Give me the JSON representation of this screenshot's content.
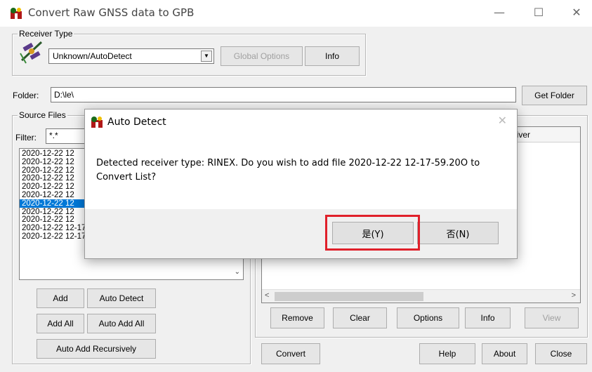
{
  "window": {
    "title": "Convert Raw GNSS data to GPB",
    "minimize": "—",
    "maximize": "☐",
    "close": "✕"
  },
  "receiver_type": {
    "group_label": "Receiver Type",
    "selected": "Unknown/AutoDetect",
    "global_options_label": "Global Options",
    "info_label": "Info"
  },
  "folder": {
    "label": "Folder:",
    "value": "D:\\le\\",
    "get_folder_label": "Get Folder"
  },
  "source_files": {
    "group_label": "Source Files",
    "filter_label": "Filter:",
    "filter_value": "*.*",
    "items": [
      "2020-12-22 12",
      "2020-12-22 12",
      "2020-12-22 12",
      "2020-12-22 12",
      "2020-12-22 12",
      "2020-12-22 12",
      "2020-12-22 12",
      "2020-12-22 12",
      "2020-12-22 12",
      "2020-12-22 12-17-59.fmnav",
      "2020-12-22 12-17-59.fpos"
    ],
    "selected_index": 6,
    "add_label": "Add",
    "auto_detect_label": "Auto Detect",
    "add_all_label": "Add All",
    "auto_add_all_label": "Auto Add All",
    "auto_add_recursively_label": "Auto Add Recursively"
  },
  "convert_list": {
    "column_header_partial": "eiver",
    "remove_label": "Remove",
    "clear_label": "Clear",
    "options_label": "Options",
    "info_label": "Info",
    "view_label": "View"
  },
  "bottom": {
    "convert_label": "Convert",
    "help_label": "Help",
    "about_label": "About",
    "close_label": "Close"
  },
  "dialog": {
    "title": "Auto Detect",
    "close": "✕",
    "message": "Detected receiver type: RINEX. Do you wish to add file 2020-12-22 12-17-59.20O to Convert List?",
    "yes_label": "是(Y)",
    "no_label": "否(N)"
  },
  "colors": {
    "highlight": "#e0202a",
    "selection": "#0078d7"
  }
}
